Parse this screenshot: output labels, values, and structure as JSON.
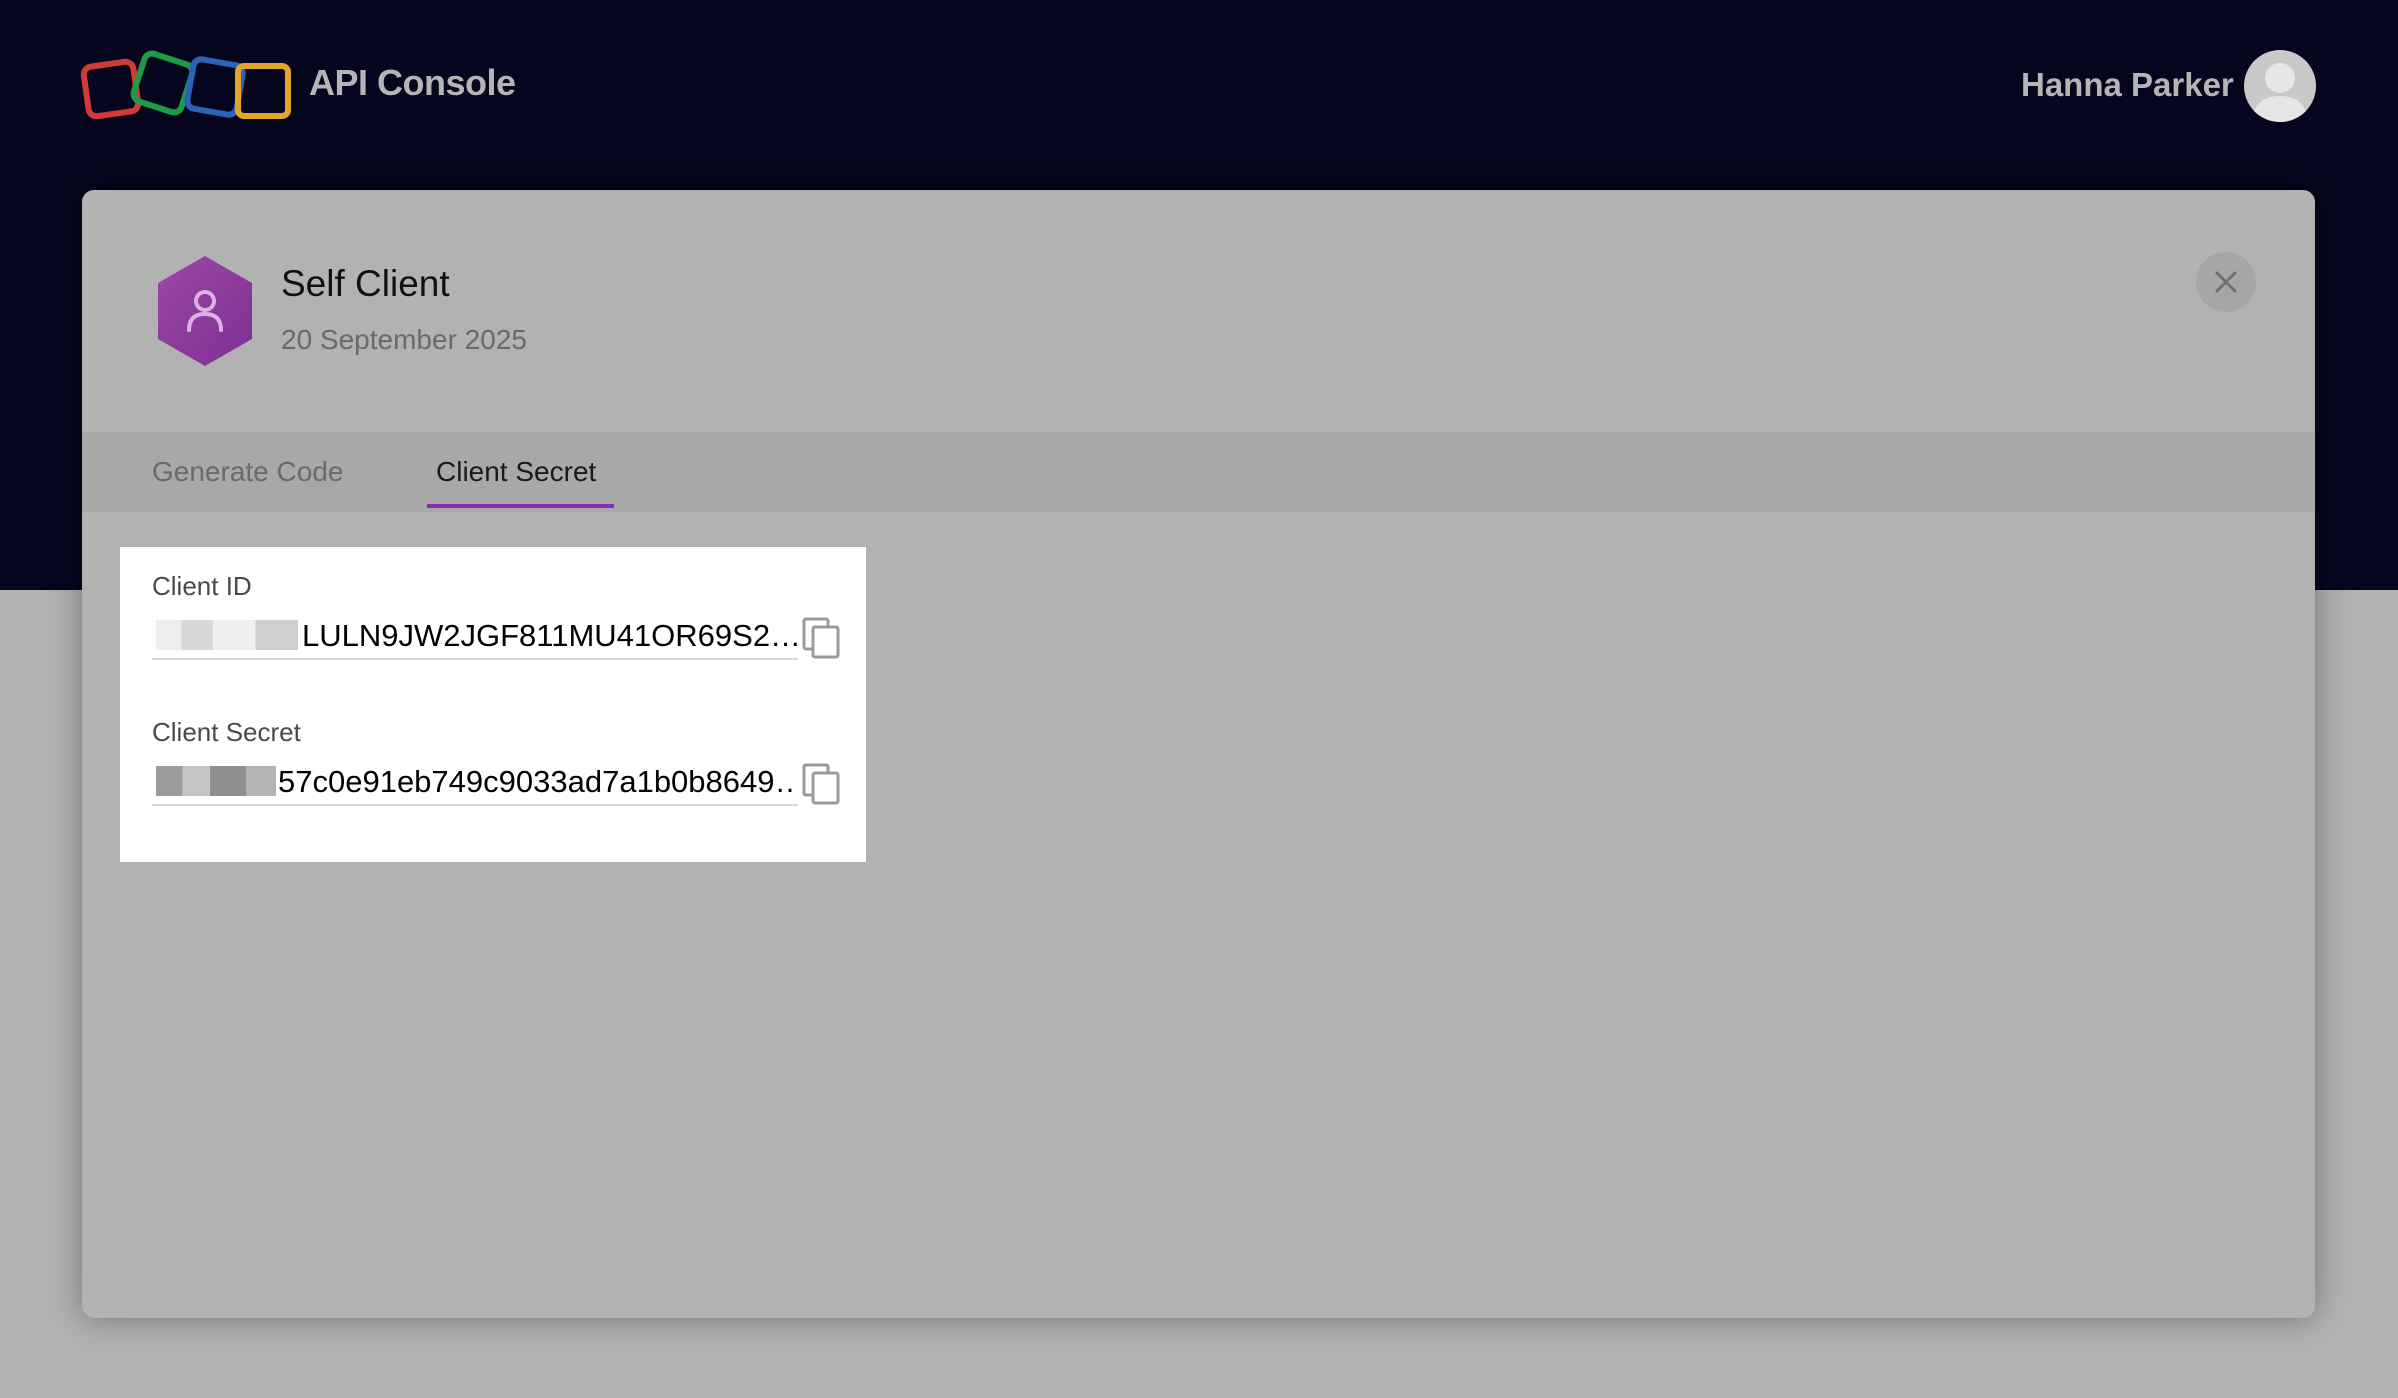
{
  "header": {
    "app_title": "API Console",
    "user_name": "Hanna Parker"
  },
  "client": {
    "name": "Self Client",
    "created_date": "20 September 2025"
  },
  "tabs": [
    {
      "label": "Generate Code",
      "active": false
    },
    {
      "label": "Client Secret",
      "active": true
    }
  ],
  "credentials": {
    "client_id_label": "Client ID",
    "client_id_value": "LULN9JW2JGF811MU41OR69S2…",
    "client_secret_label": "Client Secret",
    "client_secret_value": "57c0e91eb749c9033ad7a1b0b8649…"
  },
  "colors": {
    "header_bg": "#05051d",
    "accent": "#8a2cae",
    "logo_red": "#d23a36",
    "logo_green": "#1f9a45",
    "logo_blue": "#2a63b8",
    "logo_yellow": "#e1a527"
  },
  "icons": [
    "logo-icon",
    "avatar-icon",
    "user-hexagon-icon",
    "close-icon",
    "copy-icon"
  ]
}
